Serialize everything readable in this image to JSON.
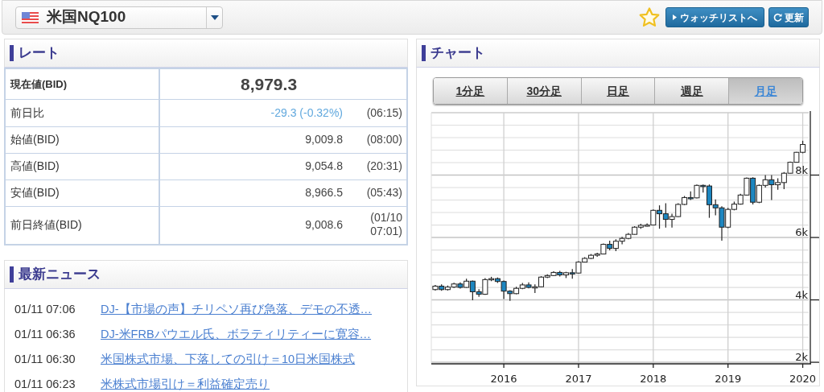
{
  "instrument_selector": {
    "value": "米国NQ100"
  },
  "toolbar": {
    "buttons": [
      "ウォッチリストへ",
      "更新"
    ]
  },
  "rate": {
    "title": "レート",
    "rows": [
      {
        "kind": "current",
        "label": "現在値(BID)",
        "value": "8,979.3"
      },
      {
        "kind": "change",
        "label": "前日比",
        "value": "-29.3 (-0.32%)",
        "time": "(06:15)"
      },
      {
        "kind": "plain",
        "label": "始値(BID)",
        "value": "9,009.8",
        "time": "(08:00)"
      },
      {
        "kind": "plain",
        "label": "高値(BID)",
        "value": "9,054.8",
        "time": "(20:31)"
      },
      {
        "kind": "plain",
        "label": "安値(BID)",
        "value": "8,966.5",
        "time": "(05:43)"
      },
      {
        "kind": "plain",
        "label": "前日終値(BID)",
        "value": "9,008.6",
        "time": "(01/10 07:01)"
      }
    ]
  },
  "news": {
    "title": "最新ニュース",
    "items": [
      {
        "time": "01/11 07:06",
        "headline": "DJ-【市場の声】チリペソ再び急落、デモの不透…"
      },
      {
        "time": "01/11 06:36",
        "headline": "DJ-米FRBパウエル氏、ボラティリティーに寛容…"
      },
      {
        "time": "01/11 06:30",
        "headline": "米国株式市場、下落しての引け＝10日米国株式"
      },
      {
        "time": "01/11 06:23",
        "headline": "米株式市場引け＝利益確定売り"
      }
    ]
  },
  "chart": {
    "title": "チャート",
    "tabs": [
      {
        "label": "1分足",
        "selected": false
      },
      {
        "label": "30分足",
        "selected": false
      },
      {
        "label": "日足",
        "selected": false
      },
      {
        "label": "週足",
        "selected": false
      },
      {
        "label": "月足",
        "selected": true
      }
    ],
    "chart_data": {
      "type": "candlestick",
      "x": [
        2015.083,
        2015.167,
        2015.25,
        2015.333,
        2015.417,
        2015.5,
        2015.583,
        2015.667,
        2015.75,
        2015.833,
        2015.917,
        2016,
        2016.083,
        2016.167,
        2016.25,
        2016.333,
        2016.417,
        2016.5,
        2016.583,
        2016.667,
        2016.75,
        2016.833,
        2016.917,
        2017,
        2017.083,
        2017.167,
        2017.25,
        2017.333,
        2017.417,
        2017.5,
        2017.583,
        2017.667,
        2017.75,
        2017.833,
        2017.917,
        2018,
        2018.083,
        2018.167,
        2018.25,
        2018.333,
        2018.417,
        2018.5,
        2018.583,
        2018.667,
        2018.75,
        2018.833,
        2018.917,
        2019,
        2019.083,
        2019.167,
        2019.25,
        2019.333,
        2019.417,
        2019.5,
        2019.583,
        2019.667,
        2019.75,
        2019.833,
        2019.917,
        2020
      ],
      "grid": true,
      "xlim": [
        2015.03,
        2020.08
      ],
      "ylim": [
        1950,
        10000
      ],
      "ohlc": [
        [
          4330,
          4480,
          4300,
          4440
        ],
        [
          4440,
          4500,
          4290,
          4330
        ],
        [
          4330,
          4460,
          4300,
          4410
        ],
        [
          4410,
          4550,
          4380,
          4510
        ],
        [
          4510,
          4560,
          4360,
          4400
        ],
        [
          4400,
          4680,
          4390,
          4600
        ],
        [
          4600,
          4620,
          3990,
          4260
        ],
        [
          4260,
          4340,
          4100,
          4180
        ],
        [
          4180,
          4700,
          4160,
          4650
        ],
        [
          4650,
          4740,
          4600,
          4680
        ],
        [
          4680,
          4720,
          4540,
          4590
        ],
        [
          4590,
          4620,
          4030,
          4280
        ],
        [
          4280,
          4310,
          3970,
          4200
        ],
        [
          4200,
          4420,
          4180,
          4370
        ],
        [
          4370,
          4540,
          4340,
          4480
        ],
        [
          4480,
          4560,
          4370,
          4400
        ],
        [
          4400,
          4500,
          4220,
          4420
        ],
        [
          4420,
          4760,
          4410,
          4730
        ],
        [
          4730,
          4820,
          4700,
          4780
        ],
        [
          4780,
          4920,
          4760,
          4880
        ],
        [
          4880,
          4930,
          4750,
          4800
        ],
        [
          4800,
          4900,
          4700,
          4870
        ],
        [
          4870,
          4990,
          4680,
          4860
        ],
        [
          4860,
          5240,
          4850,
          5210
        ],
        [
          5210,
          5370,
          5200,
          5330
        ],
        [
          5330,
          5470,
          5310,
          5430
        ],
        [
          5430,
          5510,
          5380,
          5470
        ],
        [
          5470,
          5810,
          5460,
          5780
        ],
        [
          5780,
          5900,
          5590,
          5650
        ],
        [
          5650,
          5940,
          5560,
          5880
        ],
        [
          5880,
          6020,
          5780,
          5970
        ],
        [
          5970,
          6140,
          5940,
          6100
        ],
        [
          6100,
          6360,
          6090,
          6330
        ],
        [
          6330,
          6440,
          6280,
          6390
        ],
        [
          6390,
          6450,
          6350,
          6400
        ],
        [
          6400,
          6900,
          6390,
          6870
        ],
        [
          6870,
          7030,
          6280,
          6760
        ],
        [
          6760,
          7100,
          6320,
          6580
        ],
        [
          6580,
          6760,
          6320,
          6670
        ],
        [
          6670,
          7100,
          6660,
          7060
        ],
        [
          7060,
          7330,
          7040,
          7280
        ],
        [
          7280,
          7480,
          7200,
          7270
        ],
        [
          7270,
          7700,
          7250,
          7670
        ],
        [
          7670,
          7700,
          7440,
          7650
        ],
        [
          7650,
          7700,
          6630,
          7050
        ],
        [
          7050,
          7220,
          6710,
          6950
        ],
        [
          6950,
          7000,
          5900,
          6330
        ],
        [
          6330,
          6950,
          6300,
          6900
        ],
        [
          6900,
          7150,
          6870,
          7070
        ],
        [
          7070,
          7400,
          7050,
          7360
        ],
        [
          7360,
          7920,
          7340,
          7900
        ],
        [
          7900,
          7930,
          7060,
          7130
        ],
        [
          7130,
          7700,
          7100,
          7670
        ],
        [
          7670,
          8000,
          7600,
          7850
        ],
        [
          7850,
          8000,
          7200,
          7690
        ],
        [
          7690,
          7900,
          7530,
          7760
        ],
        [
          7760,
          8100,
          7550,
          8060
        ],
        [
          8060,
          8430,
          8050,
          8410
        ],
        [
          8410,
          8740,
          8400,
          8730
        ],
        [
          8730,
          9100,
          8700,
          8980
        ]
      ],
      "xticks": [
        {
          "value": 2016,
          "label": "2016"
        },
        {
          "value": 2017,
          "label": "2017"
        },
        {
          "value": 2018,
          "label": "2018"
        },
        {
          "value": 2019,
          "label": "2019"
        },
        {
          "value": 2020,
          "label": "2020"
        }
      ],
      "yticks": [
        {
          "value": 8000,
          "label": "8k"
        },
        {
          "value": 6000,
          "label": "6k"
        },
        {
          "value": 4000,
          "label": "4k"
        },
        {
          "value": 2000,
          "label": "2k"
        }
      ]
    }
  }
}
